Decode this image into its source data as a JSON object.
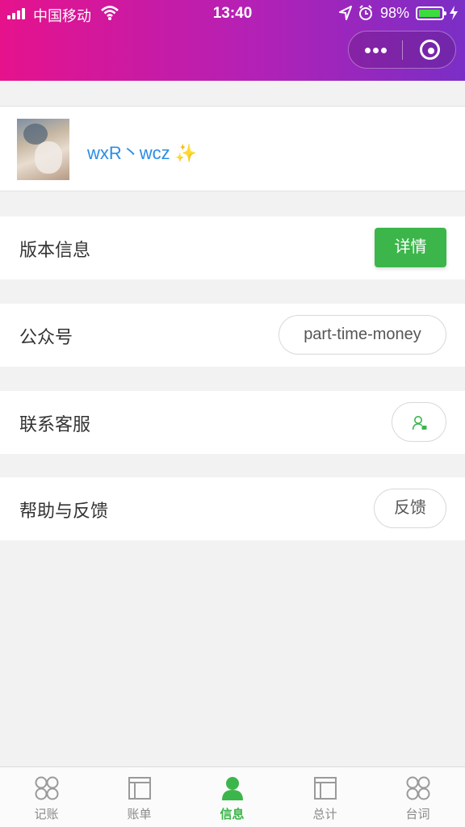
{
  "status_bar": {
    "carrier": "中国移动",
    "time": "13:40",
    "battery": "98%",
    "battery_level": 0.98
  },
  "capsule": {
    "more_icon": "more-dots-icon",
    "close_icon": "target-circle-icon"
  },
  "profile": {
    "name": "wxR丶wcz",
    "emoji": "✨"
  },
  "rows": {
    "version": {
      "label": "版本信息",
      "button": "详情"
    },
    "account": {
      "label": "公众号",
      "button": "part-time-money"
    },
    "service": {
      "label": "联系客服",
      "icon": "contact-person-icon"
    },
    "help": {
      "label": "帮助与反馈",
      "button": "反馈"
    }
  },
  "tabbar": {
    "items": [
      {
        "label": "记账",
        "icon": "four-circles-icon",
        "active": false
      },
      {
        "label": "账单",
        "icon": "layout-panel-icon",
        "active": false
      },
      {
        "label": "信息",
        "icon": "person-icon",
        "active": true
      },
      {
        "label": "总计",
        "icon": "layout-panel-icon",
        "active": false
      },
      {
        "label": "台词",
        "icon": "four-circles-icon",
        "active": false
      }
    ]
  },
  "colors": {
    "header_gradient_start": "#e6128c",
    "header_gradient_end": "#7a2ec6",
    "accent_green": "#3cb64a",
    "username_blue": "#2b8de4"
  }
}
